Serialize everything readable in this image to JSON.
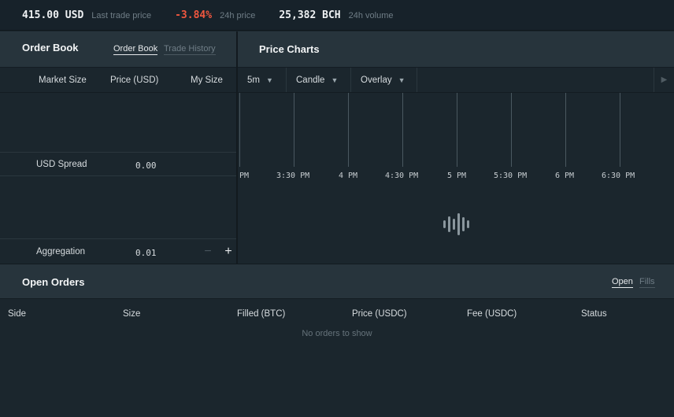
{
  "ticker": {
    "last_price": "415.00 USD",
    "last_price_label": "Last trade price",
    "change": "-3.84%",
    "change_label": "24h price",
    "volume": "25,382 BCH",
    "volume_label": "24h volume"
  },
  "order_book": {
    "title": "Order Book",
    "tabs": [
      "Order Book",
      "Trade History"
    ],
    "columns": [
      "Market Size",
      "Price (USD)",
      "My Size"
    ],
    "spread_label": "USD Spread",
    "spread_value": "0.00",
    "aggregation_label": "Aggregation",
    "aggregation_value": "0.01",
    "minus": "−",
    "plus": "+"
  },
  "price_charts": {
    "title": "Price Charts",
    "interval": "5m",
    "chart_type": "Candle",
    "overlay": "Overlay",
    "time_ticks": [
      "PM",
      "3:30 PM",
      "4 PM",
      "4:30 PM",
      "5 PM",
      "5:30 PM",
      "6 PM",
      "6:30 PM"
    ],
    "loading_icon": "waveform-loading-icon"
  },
  "open_orders": {
    "title": "Open Orders",
    "tabs": [
      "Open",
      "Fills"
    ],
    "columns": [
      "Side",
      "Size",
      "Filled (BTC)",
      "Price (USDC)",
      "Fee (USDC)",
      "Status"
    ],
    "empty_message": "No orders to show"
  },
  "colors": {
    "background": "#1b262d",
    "panel_header": "#27343c",
    "negative": "#f0573f"
  }
}
